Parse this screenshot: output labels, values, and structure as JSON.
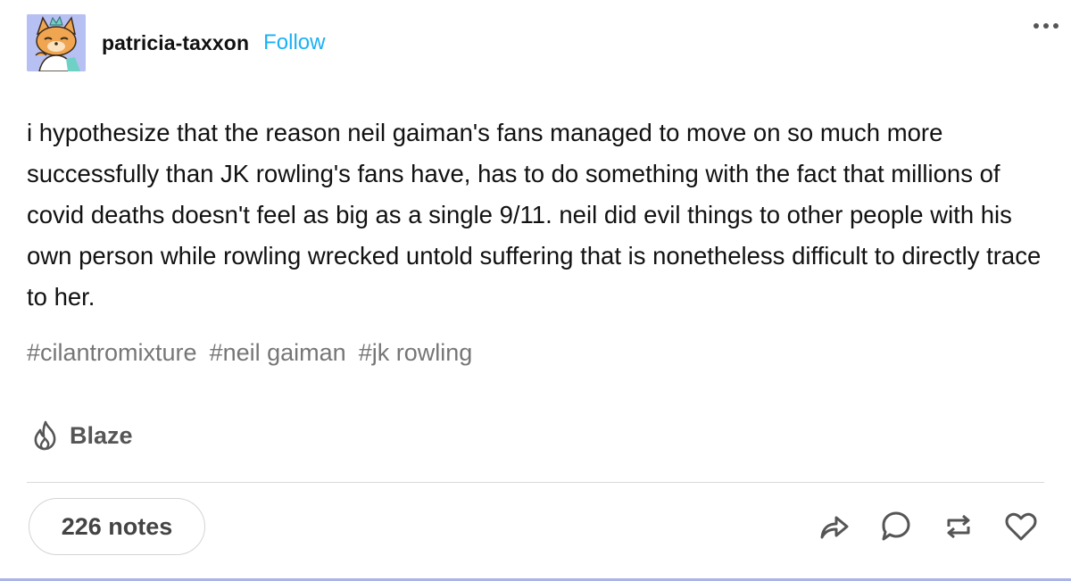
{
  "post": {
    "username": "patricia-taxxon",
    "follow_label": "Follow",
    "body": "i hypothesize that the reason neil gaiman's fans managed to move on so much more successfully than JK rowling's fans have, has to do something with the fact that millions of covid deaths doesn't feel as big as a single 9/11. neil did evil things to other people with his own person while rowling wrecked untold suffering that is nonetheless difficult to directly trace to her.",
    "tags": [
      "#cilantromixture",
      "#neil gaiman",
      "#jk rowling"
    ],
    "blaze_label": "Blaze",
    "notes_label": "226 notes"
  },
  "icons": {
    "more": "more-options-icon",
    "blaze": "flame-icon",
    "share": "share-icon",
    "reply": "reply-icon",
    "reblog": "reblog-icon",
    "like": "heart-icon"
  },
  "colors": {
    "follow": "#1ab1f5",
    "avatar_bg": "#b7c0f2",
    "tag": "#767676",
    "bottom_border": "#aab4e8"
  }
}
